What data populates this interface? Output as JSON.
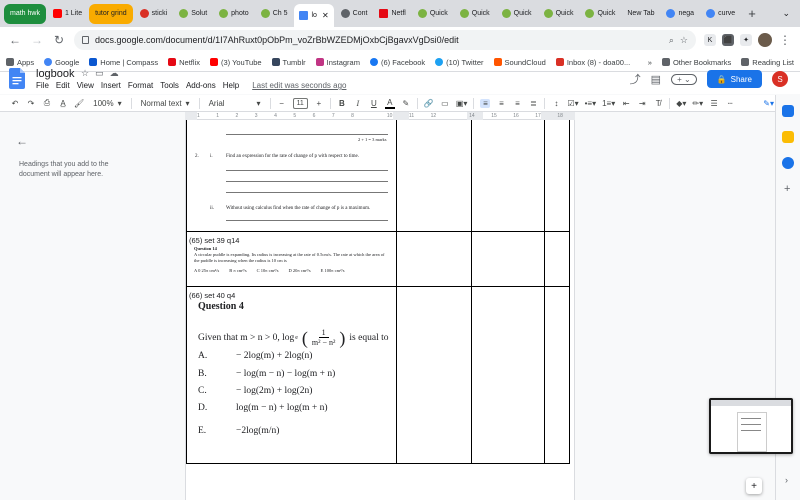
{
  "tabs": [
    {
      "label": "math hwk",
      "kind": "group-green"
    },
    {
      "label": "1 Lite",
      "color": "#ff0000"
    },
    {
      "label": "tutor grind",
      "kind": "group-yellow"
    },
    {
      "label": "sticki",
      "color": "#d93025"
    },
    {
      "label": "Solut",
      "color": "#7cb342"
    },
    {
      "label": "photo",
      "color": "#7cb342"
    },
    {
      "label": "Ch 5",
      "color": "#7cb342"
    },
    {
      "label": "lo",
      "color": "#4285f4",
      "active": true
    },
    {
      "label": "Cont",
      "color": "#5f6368"
    },
    {
      "label": "Netfl",
      "color": "#e50914"
    },
    {
      "label": "Quick",
      "color": "#7cb342"
    },
    {
      "label": "Quick",
      "color": "#7cb342"
    },
    {
      "label": "Quick",
      "color": "#7cb342"
    },
    {
      "label": "Quick",
      "color": "#7cb342"
    },
    {
      "label": "Quick",
      "color": "#7cb342"
    },
    {
      "label": "New Tab",
      "color": ""
    },
    {
      "label": "nega",
      "color": "#4285f4"
    },
    {
      "label": "curve",
      "color": "#4285f4"
    }
  ],
  "browser": {
    "url": "docs.google.com/document/d/1I7AhRuxt0pObPm_voZrBbWZEDMjOxbCjBgavxVgDsi0/edit"
  },
  "bookmarks": {
    "left": [
      {
        "label": "Apps",
        "color": "#5f6368"
      },
      {
        "label": "Google",
        "color": "#4285f4"
      },
      {
        "label": "Home | Compass",
        "color": "#0b57d0"
      },
      {
        "label": "Netflix",
        "color": "#e50914"
      },
      {
        "label": "(3) YouTube",
        "color": "#ff0000"
      },
      {
        "label": "Tumblr",
        "color": "#36465d"
      },
      {
        "label": "Instagram",
        "color": "#c13584"
      },
      {
        "label": "(6) Facebook",
        "color": "#1877f2"
      },
      {
        "label": "(10) Twitter",
        "color": "#1da1f2"
      },
      {
        "label": "SoundCloud",
        "color": "#ff5500"
      },
      {
        "label": "Inbox (8) - doa00...",
        "color": "#d93025"
      }
    ],
    "other": "Other Bookmarks",
    "reading": "Reading List"
  },
  "doc": {
    "title": "logbook",
    "menus": [
      "File",
      "Edit",
      "View",
      "Insert",
      "Format",
      "Tools",
      "Add-ons",
      "Help"
    ],
    "last_edit": "Last edit was seconds ago",
    "share": "Share",
    "avatar": "S"
  },
  "toolbar": {
    "zoom": "100%",
    "style": "Normal text",
    "font": "Arial",
    "font_size": "11"
  },
  "ruler": {
    "ticks": [
      "1",
      "1",
      "2",
      "3",
      "4",
      "5",
      "6",
      "7",
      "8",
      "",
      "10",
      "11",
      "12",
      "",
      "14",
      "15",
      "16",
      "17",
      "18"
    ]
  },
  "outline": {
    "hint": "Headings that you add to the document will appear here."
  },
  "content": {
    "top_marks": "2 + 1 = 3 marks",
    "q_num": "2.",
    "part_i": "i.",
    "part_i_text": "Find an expression for the rate of change of p with respect to time.",
    "part_ii": "ii.",
    "part_ii_text": "Without using calculus find when the rate of change of p is a maximum.",
    "set39_label": "(65) set 39 q14",
    "q14_title": "Question 14",
    "q14_text": "A circular puddle is expanding. Its radius is increasing at the rate of 0.5cm/s. The rate at which the area of the puddle is increasing when the radius is 10 cm is",
    "q14_options": [
      "A  0 25π cm²/s",
      "B  π cm²/s",
      "C  10π cm²/s",
      "D  20π cm²/s",
      "E  100π cm²/s"
    ],
    "set40_label": "(66) set 40 q4",
    "q4_title": "Question 4",
    "q4_stem_pre": "Given that m > n > 0,  log",
    "q4_sub": "e",
    "q4_num": "1",
    "q4_den": "m² − n²",
    "q4_stem_post": "is equal to",
    "q4_options": [
      {
        "letter": "A.",
        "text": "− 2log(m) + 2log(n)"
      },
      {
        "letter": "B.",
        "text": "− log(m − n) − log(m + n)"
      },
      {
        "letter": "C.",
        "text": "− log(2m) + log(2n)"
      },
      {
        "letter": "D.",
        "text": "log(m − n) + log(m + n)"
      },
      {
        "letter": "E.",
        "text": "−2log(m/n)"
      }
    ]
  },
  "colors": {
    "docs_blue": "#1a73e8",
    "tab_green": "#1e8e3e",
    "tab_yellow": "#f9ab00"
  }
}
